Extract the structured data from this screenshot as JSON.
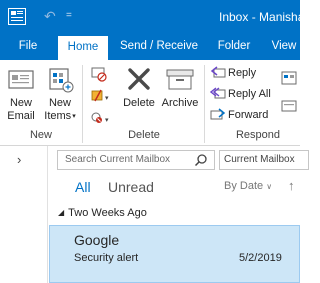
{
  "titlebar": {
    "title": "Inbox - Manisha",
    "qat_label": "="
  },
  "tabs": [
    {
      "label": "File"
    },
    {
      "label": "Home"
    },
    {
      "label": "Send / Receive"
    },
    {
      "label": "Folder"
    },
    {
      "label": "View"
    }
  ],
  "ribbon": {
    "new_group": {
      "label": "New",
      "new_email": {
        "line1": "New",
        "line2": "Email"
      },
      "new_items": {
        "line1": "New",
        "line2": "Items"
      }
    },
    "delete_group": {
      "label": "Delete",
      "delete": "Delete",
      "archive": "Archive"
    },
    "respond_group": {
      "label": "Respond",
      "reply": "Reply",
      "reply_all": "Reply All",
      "forward": "Forward"
    }
  },
  "search": {
    "placeholder": "Search Current Mailbox",
    "scope": "Current Mailbox"
  },
  "filters": {
    "all": "All",
    "unread": "Unread",
    "sort": "By Date"
  },
  "mail_list": {
    "group_header": "Two Weeks Ago",
    "items": [
      {
        "from": "Google",
        "subject": "Security alert",
        "date": "5/2/2019"
      }
    ]
  },
  "colors": {
    "brand_blue": "#0072c6",
    "selected_row": "#cde6f7",
    "delete_red": "#c42b1c"
  },
  "icons": {
    "app": "outlook-app-icon",
    "undo": "undo-icon",
    "new_email": "new-email-icon",
    "new_items": "new-items-icon",
    "ignore": "ignore-icon",
    "cleanup": "clean-up-icon",
    "junk": "junk-icon",
    "delete": "delete-x-icon",
    "archive": "archive-icon",
    "reply": "reply-icon",
    "reply_all": "reply-all-icon",
    "forward": "forward-icon",
    "search": "search-icon",
    "expand": "chevron-right-icon"
  }
}
